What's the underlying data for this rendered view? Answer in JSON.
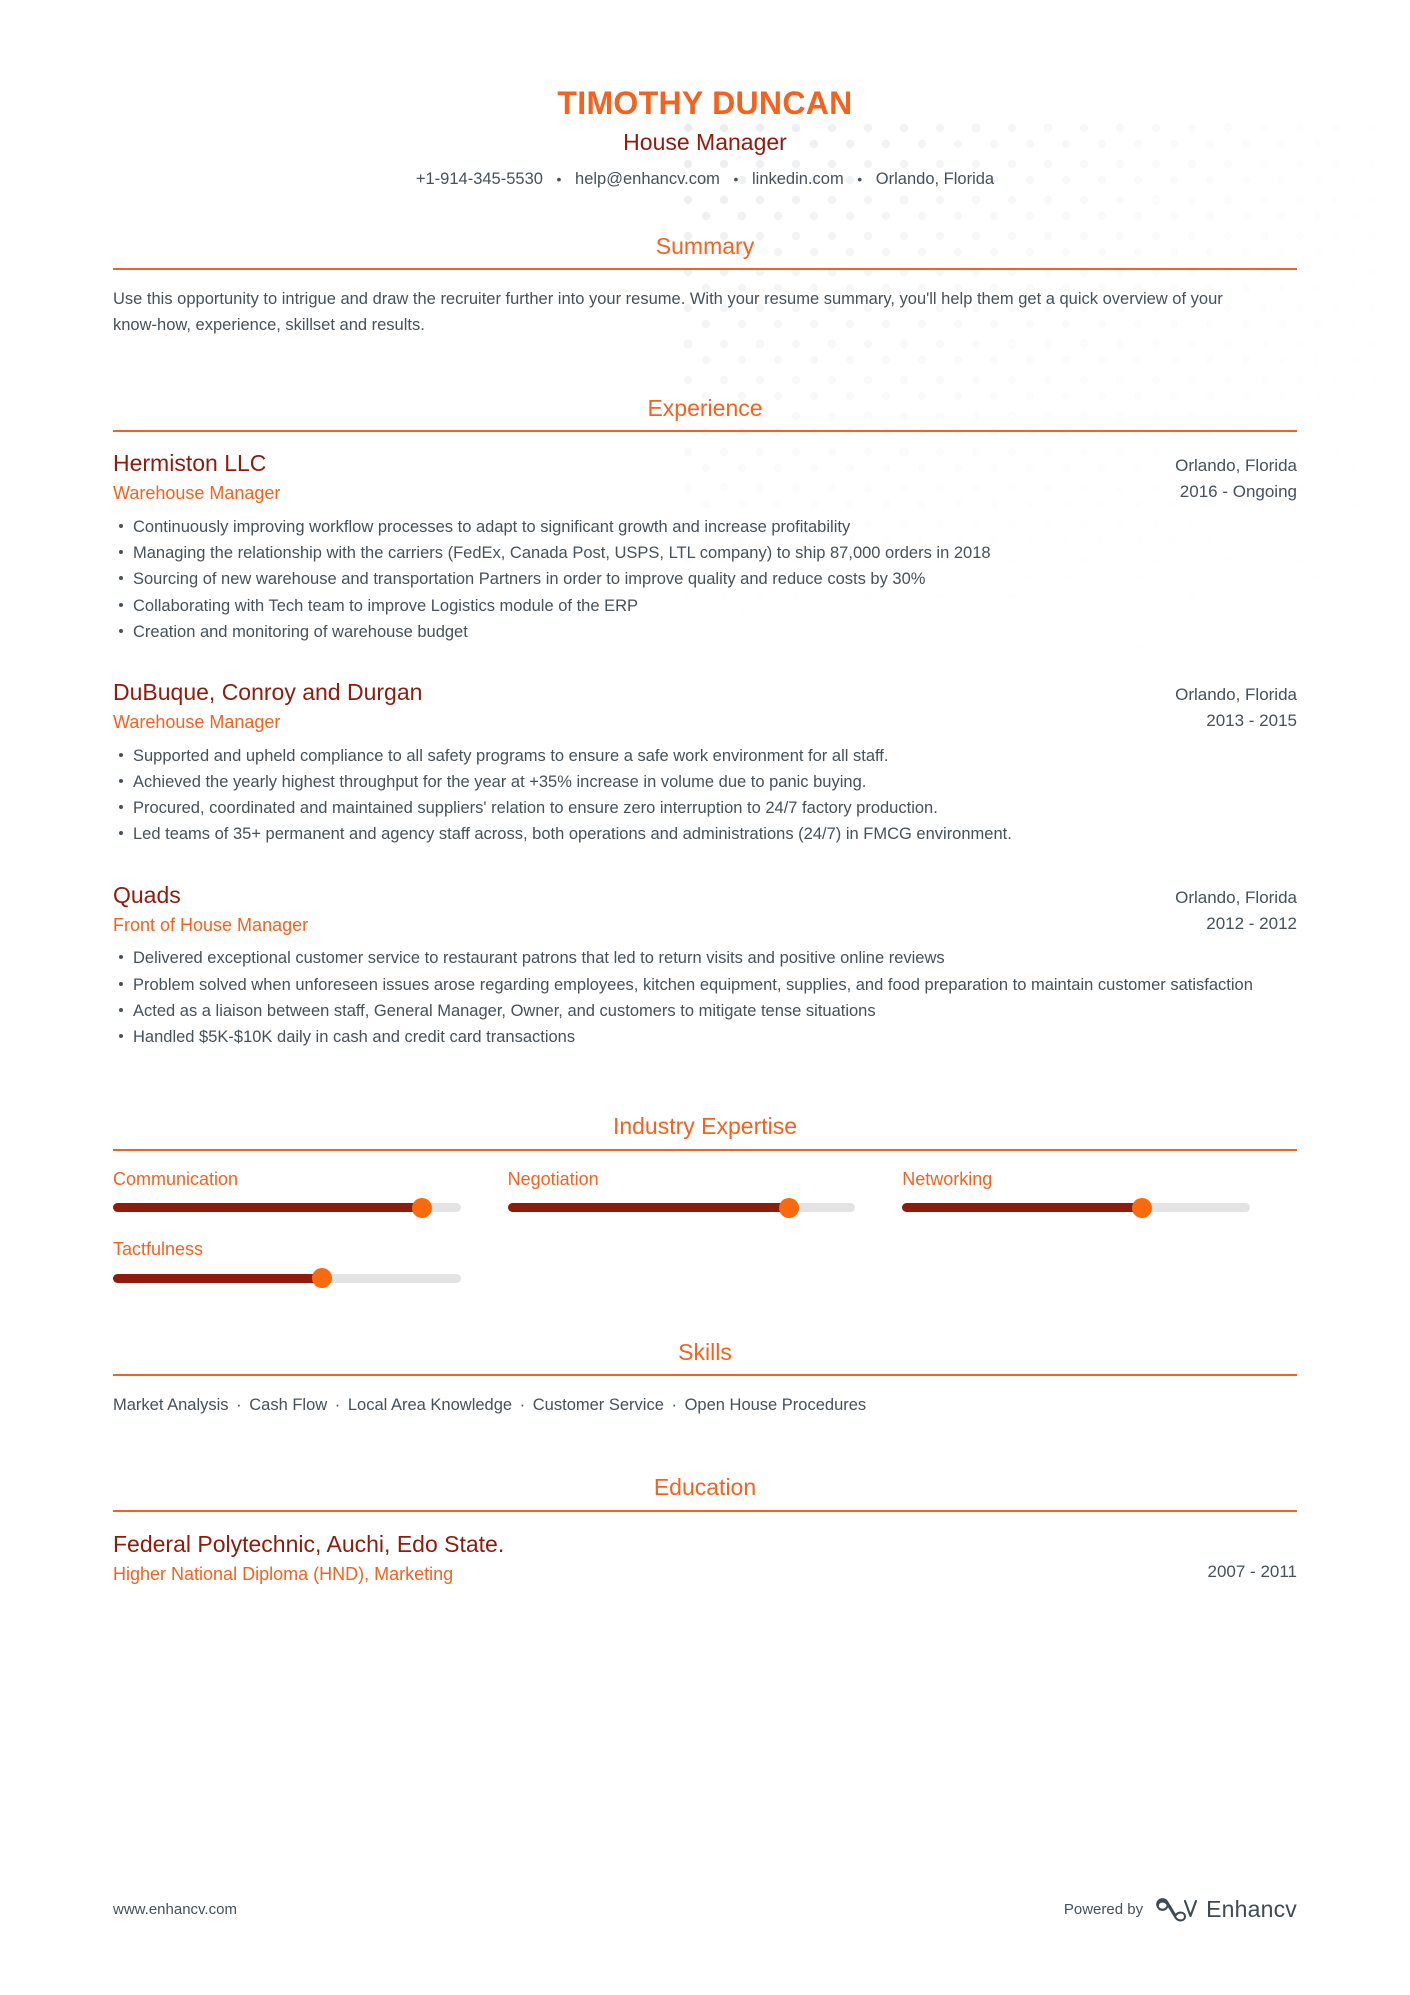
{
  "colors": {
    "accent_orange": "#f4621f",
    "dark_red": "#8e1b0c",
    "body_text": "#46515a",
    "track_gray": "#e3e3e3",
    "thumb_orange": "#f96a0d"
  },
  "header": {
    "name": "TIMOTHY DUNCAN",
    "role": "House Manager",
    "contacts": [
      "+1-914-345-5530",
      "help@enhancv.com",
      "linkedin.com",
      "Orlando, Florida"
    ],
    "separator": "•"
  },
  "sections": {
    "summary": {
      "title": "Summary",
      "text": "Use this opportunity to intrigue and draw the recruiter further into your resume. With your resume summary, you'll help them get a quick overview of your know-how, experience, skillset and results."
    },
    "experience": {
      "title": "Experience",
      "entries": [
        {
          "company": "Hermiston LLC",
          "position": "Warehouse Manager",
          "location": "Orlando, Florida",
          "dates": "2016 - Ongoing",
          "bullets": [
            "Continuously improving workflow processes to adapt to significant growth and increase profitability",
            "Managing the relationship with the carriers (FedEx, Canada Post, USPS, LTL company) to ship 87,000 orders in 2018",
            "Sourcing of new warehouse and transportation Partners in order to improve quality and reduce costs by 30%",
            "Collaborating with Tech team to improve Logistics module of the ERP",
            "Creation and monitoring of warehouse budget"
          ]
        },
        {
          "company": "DuBuque, Conroy and Durgan",
          "position": "Warehouse Manager",
          "location": "Orlando, Florida",
          "dates": "2013 - 2015",
          "bullets": [
            "Supported and upheld compliance to all safety programs to ensure a safe work environment for all staff.",
            "Achieved the yearly highest throughput for the year at +35% increase in volume due to panic buying.",
            "Procured, coordinated and maintained suppliers' relation to ensure zero interruption to 24/7 factory production.",
            "Led teams of 35+ permanent and agency staff across, both operations and administrations (24/7) in FMCG environment."
          ]
        },
        {
          "company": "Quads",
          "position": "Front of House Manager",
          "location": "Orlando, Florida",
          "dates": "2012 - 2012",
          "bullets": [
            "Delivered exceptional customer service to restaurant patrons that led to return visits and positive online reviews",
            "Problem solved when unforeseen issues arose regarding employees, kitchen equipment, supplies, and food preparation to maintain customer satisfaction",
            "Acted as a liaison between staff, General Manager, Owner, and customers to mitigate tense situations",
            "Handled $5K-$10K daily in cash and credit card transactions"
          ]
        }
      ]
    },
    "industry_expertise": {
      "title": "Industry Expertise",
      "skills": [
        {
          "label": "Communication",
          "level": 89
        },
        {
          "label": "Negotiation",
          "level": 81
        },
        {
          "label": "Networking",
          "level": 69
        },
        {
          "label": "Tactfulness",
          "level": 60
        }
      ]
    },
    "skills": {
      "title": "Skills",
      "separator": "·",
      "items": [
        "Market Analysis",
        "Cash Flow",
        "Local Area Knowledge",
        "Customer Service",
        "Open House Procedures"
      ]
    },
    "education": {
      "title": "Education",
      "entries": [
        {
          "school": "Federal Polytechnic, Auchi, Edo State.",
          "degree": "Higher National Diploma (HND), Marketing",
          "dates": "2007 - 2011"
        }
      ]
    }
  },
  "footer": {
    "url": "www.enhancv.com",
    "powered_by": "Powered by",
    "brand": "Enhancv"
  }
}
